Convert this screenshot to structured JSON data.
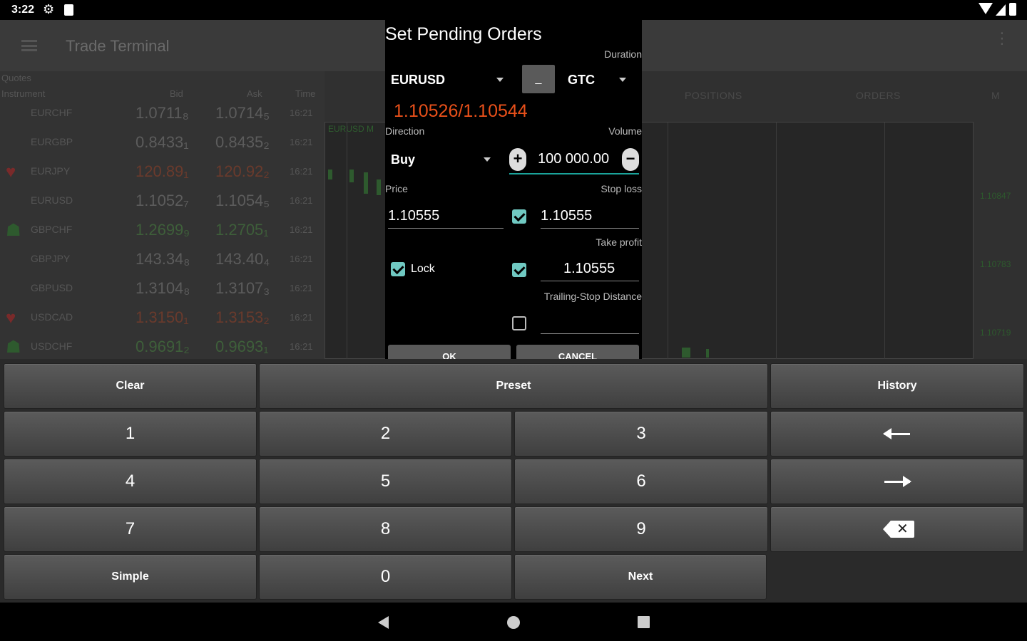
{
  "status": {
    "time": "3:22"
  },
  "app": {
    "title": "Trade Terminal",
    "quotes_section": "Quotes",
    "columns": {
      "instrument": "Instrument",
      "bid": "Bid",
      "ask": "Ask",
      "time": "Time"
    },
    "quotes": [
      {
        "symbol": "EURCHF",
        "bid": "1.0711₈",
        "ask": "1.0714₅",
        "time": "16:21",
        "trend": "none"
      },
      {
        "symbol": "EURGBP",
        "bid": "0.8433₁",
        "ask": "0.8435₂",
        "time": "16:21",
        "trend": "none"
      },
      {
        "symbol": "EURJPY",
        "bid": "120.89₁",
        "ask": "120.92₂",
        "time": "16:21",
        "trend": "down"
      },
      {
        "symbol": "EURUSD",
        "bid": "1.1052₇",
        "ask": "1.1054₅",
        "time": "16:21",
        "trend": "none"
      },
      {
        "symbol": "GBPCHF",
        "bid": "1.2699₉",
        "ask": "1.2705₁",
        "time": "16:21",
        "trend": "up"
      },
      {
        "symbol": "GBPJPY",
        "bid": "143.34₈",
        "ask": "143.40₄",
        "time": "16:21",
        "trend": "none"
      },
      {
        "symbol": "GBPUSD",
        "bid": "1.3104₈",
        "ask": "1.3107₃",
        "time": "16:21",
        "trend": "none"
      },
      {
        "symbol": "USDCAD",
        "bid": "1.3150₁",
        "ask": "1.3153₂",
        "time": "16:21",
        "trend": "down"
      },
      {
        "symbol": "USDCHF",
        "bid": "0.9691₂",
        "ask": "0.9693₁",
        "time": "16:21",
        "trend": "up"
      }
    ],
    "chart_symbol": "EURUSD M",
    "tabs": {
      "positions": "POSITIONS",
      "orders": "ORDERS",
      "more": "M"
    },
    "price_axis": [
      "1.10847",
      "1.10783",
      "1.10719"
    ]
  },
  "dialog": {
    "title": "Set Pending Orders",
    "duration_label": "Duration",
    "instrument": "EURUSD",
    "dash_button": "_",
    "duration": "GTC",
    "price_quote": "1.10526/1.10544",
    "direction_label": "Direction",
    "direction": "Buy",
    "volume_label": "Volume",
    "volume": "100 000.00",
    "price_label": "Price",
    "price": "1.10555",
    "stop_loss_label": "Stop loss",
    "stop_loss": "1.10555",
    "take_profit_label": "Take profit",
    "take_profit": "1.10555",
    "lock_label": "Lock",
    "trailing_label": "Trailing-Stop Distance",
    "trailing_value": "",
    "ok_button": "OK",
    "cancel_button": "CANCEL",
    "colors": {
      "price_quote": "#e8501a",
      "accent": "#1aa39a",
      "checkbox": "#70c9c2"
    }
  },
  "keypad": {
    "clear": "Clear",
    "preset": "Preset",
    "history": "History",
    "digits": [
      "1",
      "2",
      "3",
      "4",
      "5",
      "6",
      "7",
      "8",
      "9",
      "0"
    ],
    "simple": "Simple",
    "next": "Next",
    "icons": {
      "left": "arrow-left-icon",
      "right": "arrow-right-icon",
      "backspace": "backspace-icon"
    }
  }
}
